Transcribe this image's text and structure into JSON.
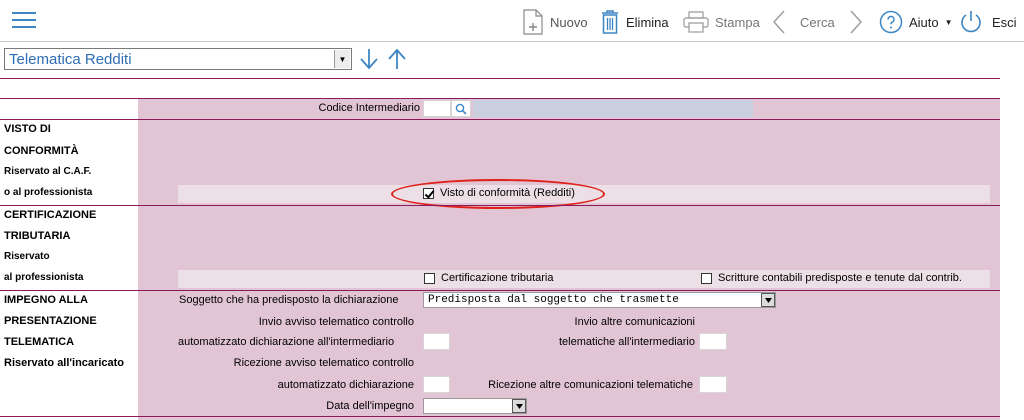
{
  "toolbar": {
    "nuovo": "Nuovo",
    "elimina": "Elimina",
    "stampa": "Stampa",
    "cerca": "Cerca",
    "aiuto": "Aiuto",
    "esci": "Esci"
  },
  "selector": {
    "value": "Telematica Redditi"
  },
  "form": {
    "codice_intermediario_label": "Codice Intermediario",
    "sections": {
      "visto": [
        "VISTO DI",
        "CONFORMITÀ",
        "Riservato al C.A.F.",
        "o al professionista"
      ],
      "certificazione": [
        "CERTIFICAZIONE",
        "TRIBUTARIA",
        "Riservato",
        "al professionista"
      ],
      "impegno": [
        "IMPEGNO ALLA",
        "PRESENTAZIONE",
        "TELEMATICA",
        "Riservato all'incaricato"
      ]
    },
    "visto_checkbox": {
      "label": "Visto di conformità (Redditi)",
      "checked": true
    },
    "cert_checkbox": {
      "label": "Certificazione tributaria",
      "checked": false
    },
    "scritture_checkbox": {
      "label": "Scritture contabili predisposte e tenute dal contrib.",
      "checked": false
    },
    "soggetto_label": "Soggetto che ha predisposto la dichiarazione",
    "soggetto_value": "Predisposta dal soggetto che trasmette",
    "invio_avviso_l1": "Invio avviso telematico controllo",
    "invio_avviso_l2": "automatizzato dichiarazione all'intermediario",
    "invio_altre_l1": "Invio altre comunicazioni",
    "invio_altre_l2": "telematiche all'intermediario",
    "ricezione_avviso_l1": "Ricezione avviso telematico controllo",
    "ricezione_avviso_l2": "automatizzato dichiarazione",
    "ricezione_altre": "Ricezione altre comunicazioni telematiche",
    "data_impegno_label": "Data dell'impegno",
    "data_impegno_value": ""
  },
  "colors": {
    "accent": "#3d86c6",
    "panel_pink": "#e2c5d4",
    "divider": "#8b1a5a",
    "highlight_ellipse": "#e0201a"
  }
}
